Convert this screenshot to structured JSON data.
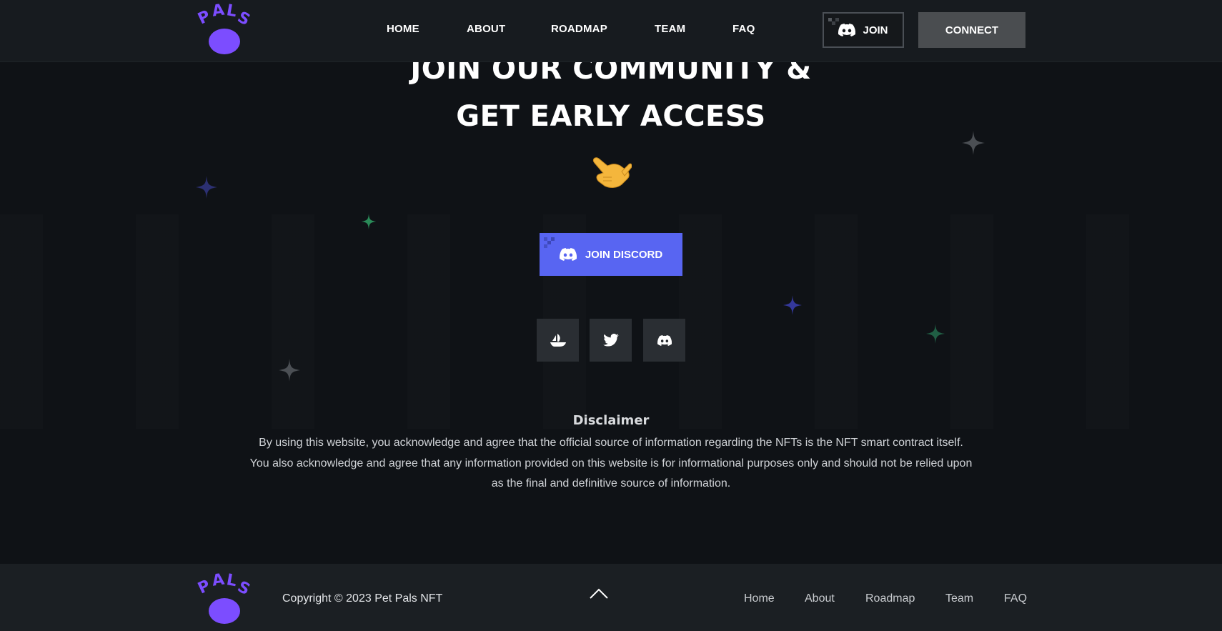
{
  "brand": {
    "logo_text": "PALS",
    "logo_color": "#7c4dff"
  },
  "nav": {
    "items": [
      "HOME",
      "ABOUT",
      "ROADMAP",
      "TEAM",
      "FAQ"
    ],
    "join_label": "JOIN",
    "connect_label": "CONNECT"
  },
  "hero": {
    "title_line1": "JOIN OUR COMMUNITY &",
    "title_line2": "GET EARLY ACCESS",
    "emoji_icon": "call-me-hand-icon",
    "discord_button_label": "JOIN DISCORD",
    "discord_color": "#5865f2"
  },
  "social": [
    "opensea-icon",
    "twitter-icon",
    "discord-icon"
  ],
  "disclaimer": {
    "title": "Disclaimer",
    "line1": "By using this website, you acknowledge and agree that the official source of information regarding the NFTs is the NFT smart contract itself.",
    "line2": "You also acknowledge and agree that any information provided on this website is for informational purposes only and should not be relied upon",
    "line3": "as the final and definitive source of information."
  },
  "footer": {
    "copyright": "Copyright © 2023 Pet Pals NFT",
    "links": [
      "Home",
      "About",
      "Roadmap",
      "Team",
      "FAQ"
    ]
  },
  "colors": {
    "background": "#0f1216",
    "header": "#171b1f",
    "footer": "#1b1f23",
    "sparkle_blue": "#3a3f9a",
    "sparkle_green": "#2e8f5e",
    "sparkle_gray": "#4b4f54"
  }
}
